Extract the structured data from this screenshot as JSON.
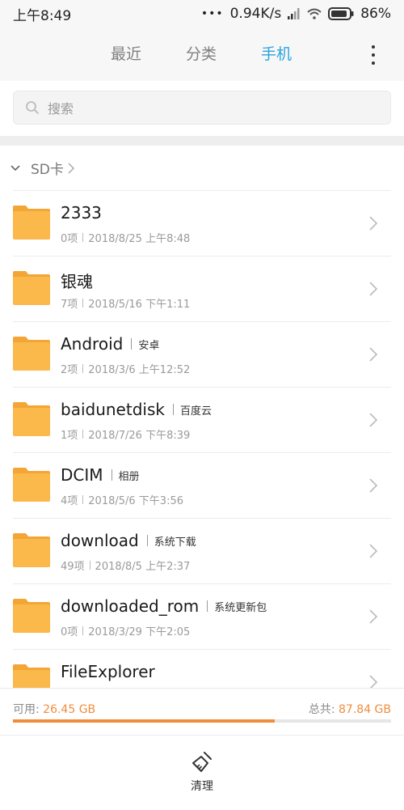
{
  "status_bar": {
    "time": "上午8:49",
    "network_speed": "0.94K/s",
    "battery": "86%"
  },
  "header": {
    "tabs": [
      {
        "label": "最近",
        "active": false
      },
      {
        "label": "分类",
        "active": false
      },
      {
        "label": "手机",
        "active": true
      }
    ],
    "more_icon": "more-vertical-icon"
  },
  "search": {
    "placeholder": "搜索"
  },
  "breadcrumb": {
    "label": "SD卡"
  },
  "files": [
    {
      "name": "2333",
      "tag": "",
      "meta_count": "0项",
      "meta_date": "2018/8/25 上午8:48"
    },
    {
      "name": "银魂",
      "tag": "",
      "meta_count": "7项",
      "meta_date": "2018/5/16 下午1:11"
    },
    {
      "name": "Android",
      "tag": "安卓",
      "meta_count": "2项",
      "meta_date": "2018/3/6 上午12:52"
    },
    {
      "name": "baidunetdisk",
      "tag": "百度云",
      "meta_count": "1项",
      "meta_date": "2018/7/26 下午8:39"
    },
    {
      "name": "DCIM",
      "tag": "相册",
      "meta_count": "4项",
      "meta_date": "2018/5/6 下午3:56"
    },
    {
      "name": "download",
      "tag": "系统下载",
      "meta_count": "49项",
      "meta_date": "2018/8/5 上午2:37"
    },
    {
      "name": "downloaded_rom",
      "tag": "系统更新包",
      "meta_count": "0项",
      "meta_date": "2018/3/29 下午2:05"
    },
    {
      "name": "FileExplorer",
      "tag": "",
      "meta_count": "",
      "meta_date": ""
    }
  ],
  "storage": {
    "available_label": "可用:",
    "available_value": "26.45 GB",
    "total_label": "总共:",
    "total_value": "87.84 GB",
    "used_fraction": 0.693
  },
  "bottom_bar": {
    "clean_label": "清理"
  },
  "colors": {
    "accent_blue": "#2ba3e0",
    "accent_orange": "#f08d3c",
    "folder_yellow": "#fbb84b"
  }
}
